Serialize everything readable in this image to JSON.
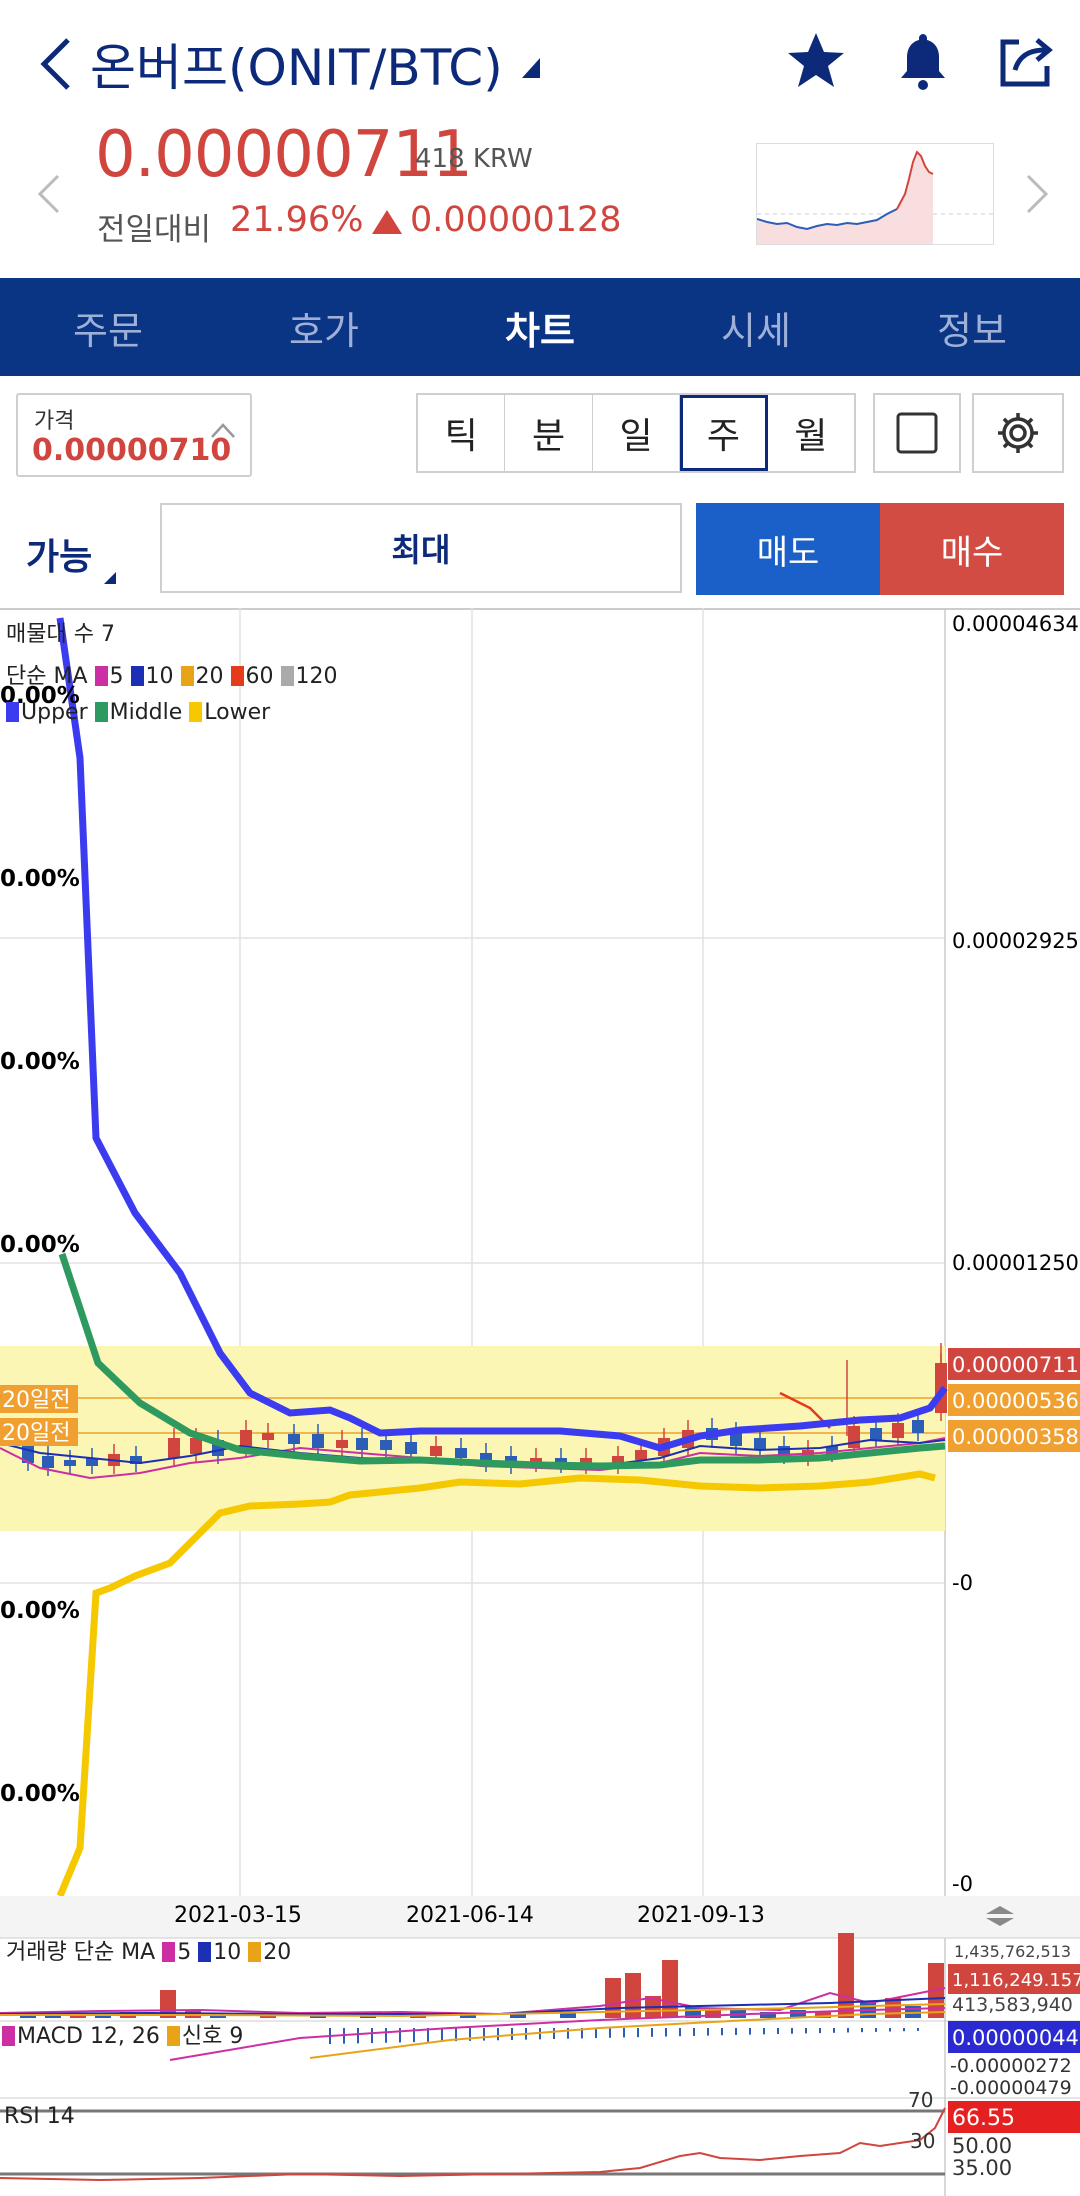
{
  "header": {
    "title": "온버프(ONIT/BTC)",
    "price": "0.00000711",
    "price_krw": "418 KRW",
    "change_label": "전일대비",
    "change_pct": "21.96%",
    "change_amount": "0.00000128"
  },
  "tabs": [
    {
      "label": "주문"
    },
    {
      "label": "호가"
    },
    {
      "label": "차트"
    },
    {
      "label": "시세"
    },
    {
      "label": "정보"
    }
  ],
  "active_tab": "차트",
  "price_box": {
    "label": "가격",
    "value": "0.00000710"
  },
  "periods": [
    "틱",
    "분",
    "일",
    "주",
    "월"
  ],
  "selected_period": "주",
  "order": {
    "available_label": "가능",
    "max_label": "최대",
    "sell_label": "매도",
    "buy_label": "매수"
  },
  "colors": {
    "brand_navy": "#0a3484",
    "up_red": "#d0453e",
    "sell_blue": "#1b5fc9",
    "upper": "#3b3bf0",
    "middle": "#2f9a5f",
    "lower": "#f5c800"
  },
  "legend": {
    "volume_profile": "매물대 수 7",
    "ma_label": "단순 MA",
    "ma_periods": [
      "5",
      "10",
      "20",
      "60",
      "120"
    ],
    "bb_upper": "Upper",
    "bb_middle": "Middle",
    "bb_lower": "Lower"
  },
  "overlay_pct_labels": [
    "0.00%",
    "0.00%",
    "0.00%",
    "0.00%",
    "0.00%",
    "0.00%"
  ],
  "band_labels": [
    "20일전",
    "20일전"
  ],
  "y_axis": [
    "0.00004634",
    "0.00002925",
    "0.00001250",
    "-0",
    "-0"
  ],
  "price_tags": {
    "current": "0.00000711",
    "level1": "0.00000536",
    "level2": "0.00000358"
  },
  "x_axis": [
    "2021-03-15",
    "2021-06-14",
    "2021-09-13"
  ],
  "volume_panel": {
    "label": "거래량 단순 MA",
    "ma_periods": [
      "5",
      "10",
      "20"
    ],
    "tag_top": "1,435,762,513",
    "tag_current": "1,116,249.157",
    "tag_overlap": "413,583,940"
  },
  "macd_panel": {
    "label": "MACD 12, 26",
    "signal_label": "신호 9",
    "tag_current": "0.00000044",
    "y1": "-0.00000272",
    "y2": "-0.00000479"
  },
  "rsi_panel": {
    "label": "RSI 14",
    "level70": "70",
    "level30": "30",
    "tag_current": "66.55",
    "y50": "50.00",
    "y35": "35.00"
  },
  "chart_data": {
    "type": "candlestick",
    "interval": "weekly",
    "x_tick_labels": [
      "2021-03-15",
      "2021-06-14",
      "2021-09-13"
    ],
    "y_range": [
      0,
      4.634e-05
    ],
    "series": [
      {
        "name": "Upper",
        "values": [
          4.72e-05,
          4.2e-05,
          2.7e-05,
          2.3e-05,
          2e-05,
          1.5e-05,
          1.1e-05,
          9e-06,
          8.5e-06,
          8.4e-06,
          7.8e-06,
          7.7e-06,
          7.6e-06,
          7.2e-06,
          7.6e-06,
          7.3e-06,
          7.5e-06,
          8.2e-06
        ]
      },
      {
        "name": "Middle",
        "values": [
          1.2e-05,
          9e-06,
          8e-06,
          7e-06,
          6.5e-06,
          6.2e-06,
          5.8e-06,
          5.7e-06,
          5.6e-06,
          5.5e-06,
          5.4e-06,
          5.3e-06,
          5.4e-06,
          5.5e-06,
          5.6e-06,
          5.7e-06,
          5.8e-06,
          6e-06
        ]
      },
      {
        "name": "Lower",
        "values": [
          -1.8e-05,
          -1e-05,
          -6e-06,
          -4.5e-06,
          -3e-06,
          -1e-06,
          3e-06,
          3.5e-06,
          4e-06,
          4.5e-06,
          4.8e-06,
          4.7e-06,
          4.6e-06,
          4.6e-06,
          4.5e-06,
          4.6e-06,
          4.8e-06,
          4.5e-06
        ]
      }
    ],
    "current_price": 7.11e-06
  }
}
